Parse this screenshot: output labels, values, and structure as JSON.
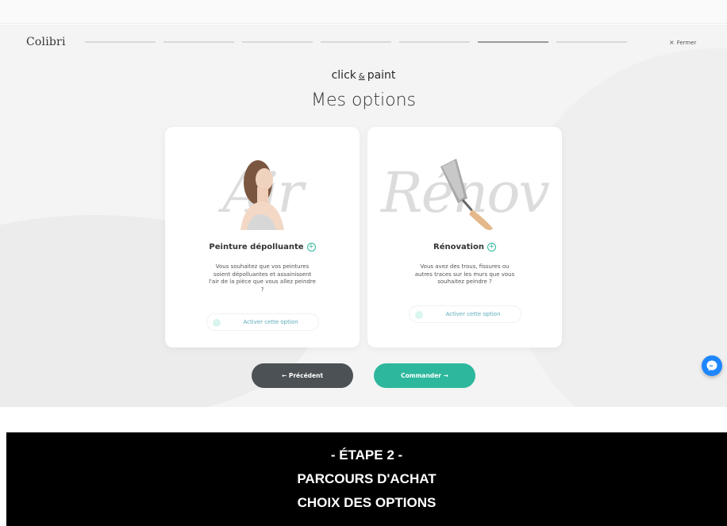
{
  "app": {
    "logo": "Colibri",
    "close_label": "Fermer",
    "close_glyph": "×",
    "progress": {
      "total_steps": 7,
      "active_step": 6
    }
  },
  "header": {
    "brand_left": "click",
    "brand_amp": "&",
    "brand_right": "paint",
    "title": "Mes options"
  },
  "cards": [
    {
      "script_word": "Air",
      "title": "Peinture dépolluante",
      "plus": "+",
      "description": "Vous souhaitez que vos peintures soient dépolluantes et assainissent l'air de la pièce que vous allez peindre ?",
      "toggle_label": "Activer cette option",
      "toggle_on": false
    },
    {
      "script_word": "Rénov",
      "title": "Rénovation",
      "plus": "+",
      "description": "Vous avez des trous, fissures ou autres traces sur les murs que vous souhaitez peindre ?",
      "toggle_label": "Activer cette option",
      "toggle_on": false
    }
  ],
  "nav": {
    "prev_label": "← Précédent",
    "next_label": "Commander →"
  },
  "footer": {
    "line1": "- ÉTAPE 2 -",
    "line2": "PARCOURS D'ACHAT",
    "line3": "CHOIX DES OPTIONS"
  },
  "colors": {
    "accent": "#2db89d",
    "dark_button": "#4b5155",
    "chat": "#1e86ff"
  },
  "icons": {
    "chat": "messenger-icon",
    "close": "close-icon",
    "plus": "plus-circle-icon"
  }
}
